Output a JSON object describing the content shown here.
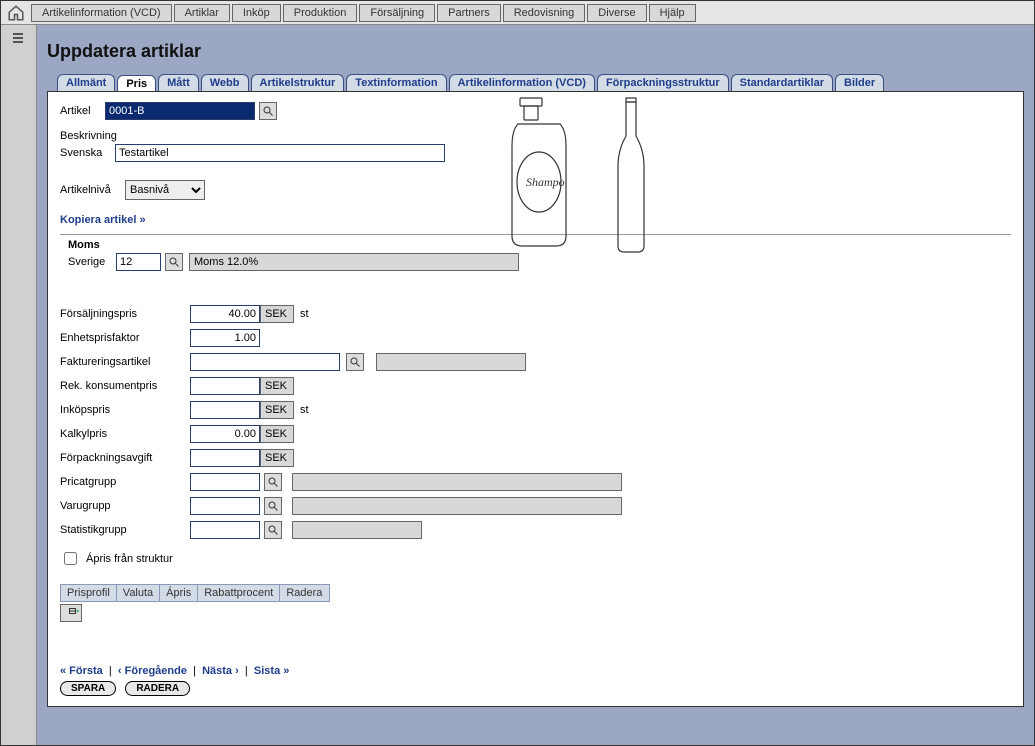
{
  "menu": {
    "items": [
      "Artikelinformation (VCD)",
      "Artiklar",
      "Inköp",
      "Produktion",
      "Försäljning",
      "Partners",
      "Redovisning",
      "Diverse",
      "Hjälp"
    ]
  },
  "page_title": "Uppdatera artiklar",
  "tabs": [
    {
      "label": "Allmänt"
    },
    {
      "label": "Pris",
      "active": true
    },
    {
      "label": "Mått"
    },
    {
      "label": "Webb"
    },
    {
      "label": "Artikelstruktur"
    },
    {
      "label": "Textinformation"
    },
    {
      "label": "Artikelinformation (VCD)"
    },
    {
      "label": "Förpackningsstruktur"
    },
    {
      "label": "Standardartiklar"
    },
    {
      "label": "Bilder"
    }
  ],
  "article": {
    "label": "Artikel",
    "value": "0001-B"
  },
  "description": {
    "label": "Beskrivning",
    "lang_label": "Svenska",
    "value": "Testartikel"
  },
  "article_level": {
    "label": "Artikelnivå",
    "selected": "Basnivå"
  },
  "copy_link": "Kopiera artikel »",
  "vat": {
    "section_title": "Moms",
    "country_label": "Sverige",
    "code": "12",
    "desc": "Moms 12.0%"
  },
  "prices": {
    "sales": {
      "label": "Försäljningspris",
      "value": "40.00",
      "currency": "SEK",
      "unit": "st"
    },
    "unit_factor": {
      "label": "Enhetsprisfaktor",
      "value": "1.00"
    },
    "invoicing": {
      "label": "Faktureringsartikel",
      "value": ""
    },
    "rec_consumer": {
      "label": "Rek. konsumentpris",
      "value": "",
      "currency": "SEK"
    },
    "purchase": {
      "label": "Inköpspris",
      "value": "",
      "currency": "SEK",
      "unit": "st"
    },
    "calc": {
      "label": "Kalkylpris",
      "value": "0.00",
      "currency": "SEK"
    },
    "packaging_fee": {
      "label": "Förpackningsavgift",
      "value": "",
      "currency": "SEK"
    },
    "pricat": {
      "label": "Pricatgrupp",
      "value": ""
    },
    "goods": {
      "label": "Varugrupp",
      "value": ""
    },
    "stat": {
      "label": "Statistikgrupp",
      "value": ""
    },
    "aprice_struct": {
      "label": "Ápris från struktur"
    }
  },
  "mini_table": {
    "headers": [
      "Prisprofil",
      "Valuta",
      "Ápris",
      "Rabattprocent",
      "Radera"
    ]
  },
  "nav": {
    "first": "« Första",
    "prev": "‹ Föregående",
    "next": "Nästa ›",
    "last": "Sista »",
    "save": "SPARA",
    "delete": "RADERA"
  }
}
